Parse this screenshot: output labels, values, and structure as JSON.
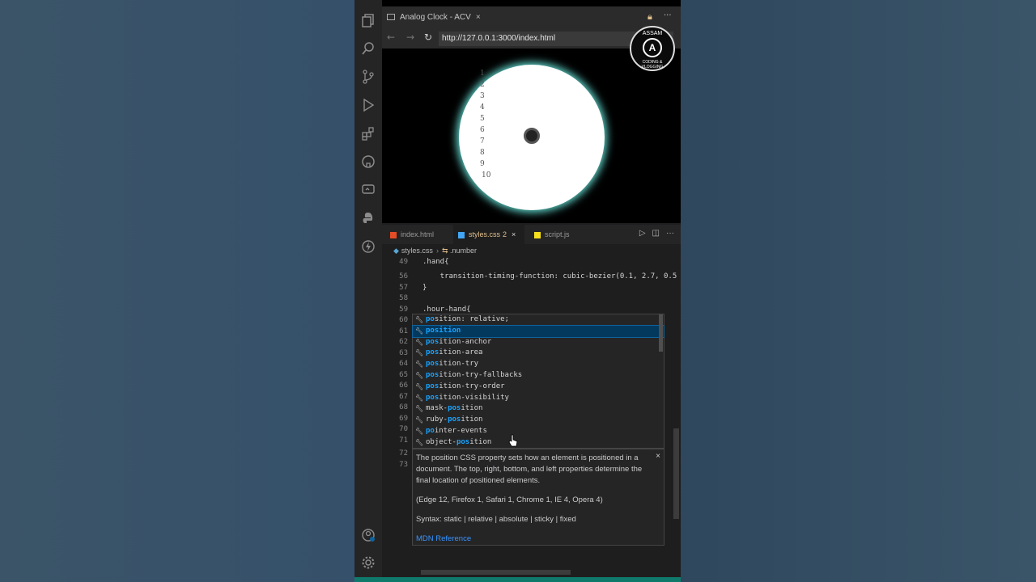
{
  "browser": {
    "tab_title": "Analog Clock - ACV",
    "close": "×",
    "url": "http://127.0.0.1:3000/index.html",
    "back": "←",
    "forward": "→",
    "reload": "↻",
    "more": "···"
  },
  "clock": {
    "numbers": [
      "1",
      "2",
      "3",
      "4",
      "5",
      "6",
      "7",
      "8",
      "9",
      "10"
    ],
    "face_color": "#ffffff",
    "glow_color": "#5fd3c9"
  },
  "watermark": {
    "top": "ASSAM",
    "logo": "A",
    "bottom": "CODING & VLOGGING"
  },
  "editor": {
    "tabs": [
      {
        "label": "index.html",
        "badge": "",
        "icon_color": "#e44d26"
      },
      {
        "label": "styles.css",
        "badge": "2",
        "icon_color": "#42a5f5"
      },
      {
        "label": "script.js",
        "badge": "",
        "icon_color": "#f7df1e"
      }
    ],
    "tab_close": "×",
    "run": "▷",
    "split": "◫",
    "more": "···",
    "breadcrumb": {
      "file": "styles.css",
      "symbol": ".number"
    },
    "lines": [
      {
        "n": "49",
        "code": ".hand{"
      },
      {
        "n": "56",
        "code": "    transition-timing-function: cubic-bezier(0.1, 2.7, 0.5"
      },
      {
        "n": "57",
        "code": "}"
      },
      {
        "n": "58",
        "code": ""
      },
      {
        "n": "59",
        "code": ".hour-hand{"
      },
      {
        "n": "60",
        "code": ""
      },
      {
        "n": "61",
        "code": ""
      },
      {
        "n": "62",
        "code": ""
      },
      {
        "n": "63",
        "code": ""
      },
      {
        "n": "64",
        "code": ""
      },
      {
        "n": "65",
        "code": ""
      },
      {
        "n": "66",
        "code": ""
      },
      {
        "n": "67",
        "code": ""
      },
      {
        "n": "68",
        "code": ""
      },
      {
        "n": "69",
        "code": ""
      },
      {
        "n": "70",
        "code": ""
      },
      {
        "n": "71",
        "code": ""
      },
      {
        "n": "72",
        "code": ""
      },
      {
        "n": "73",
        "code": ""
      }
    ]
  },
  "suggest": {
    "items": [
      {
        "pre": "",
        "hl": "po",
        "rest": "sition: relative;"
      },
      {
        "pre": "",
        "hl": "position",
        "rest": ""
      },
      {
        "pre": "",
        "hl": "pos",
        "rest": "ition-anchor"
      },
      {
        "pre": "",
        "hl": "pos",
        "rest": "ition-area"
      },
      {
        "pre": "",
        "hl": "pos",
        "rest": "ition-try"
      },
      {
        "pre": "",
        "hl": "pos",
        "rest": "ition-try-fallbacks"
      },
      {
        "pre": "",
        "hl": "pos",
        "rest": "ition-try-order"
      },
      {
        "pre": "",
        "hl": "pos",
        "rest": "ition-visibility"
      },
      {
        "pre": "mask-",
        "hl": "pos",
        "rest": "ition"
      },
      {
        "pre": "ruby-",
        "hl": "pos",
        "rest": "ition"
      },
      {
        "pre": "",
        "hl": "po",
        "rest": "inter-events"
      },
      {
        "pre": "object-",
        "hl": "pos",
        "rest": "ition"
      }
    ],
    "selected_index": 1
  },
  "docs": {
    "description": "The position CSS property sets how an element is positioned in a document. The top, right, bottom, and left properties determine the final location of positioned elements.",
    "browsers": "(Edge 12, Firefox 1, Safari 1, Chrome 1, IE 4, Opera 4)",
    "syntax": "Syntax: static | relative | absolute | sticky | fixed",
    "link": "MDN Reference",
    "close": "×"
  }
}
